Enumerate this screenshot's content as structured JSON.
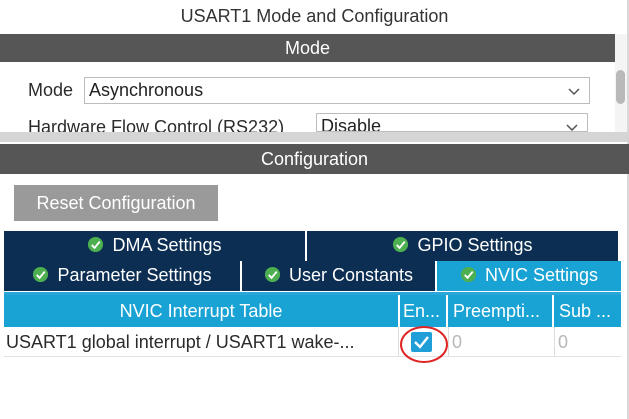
{
  "window": {
    "title": "USART1 Mode and Configuration"
  },
  "mode_section": {
    "header": "Mode",
    "rows": [
      {
        "label": "Mode",
        "value": "Asynchronous",
        "icon": "chevron-down-icon"
      },
      {
        "label": "Hardware Flow Control (RS232)",
        "value": "Disable",
        "icon": "chevron-down-icon"
      }
    ]
  },
  "configuration_section": {
    "header": "Configuration",
    "reset_label": "Reset Configuration",
    "tabs": [
      {
        "label": "DMA Settings",
        "icon": "check-circle-icon",
        "active": false
      },
      {
        "label": "GPIO Settings",
        "icon": "check-circle-icon",
        "active": false
      },
      {
        "label": "Parameter Settings",
        "icon": "check-circle-icon",
        "active": false
      },
      {
        "label": "User Constants",
        "icon": "check-circle-icon",
        "active": false
      },
      {
        "label": "NVIC Settings",
        "icon": "check-circle-icon",
        "active": true
      }
    ],
    "nvic_table": {
      "columns": [
        "NVIC Interrupt Table",
        "En...",
        "Preempti...",
        "Sub ..."
      ],
      "rows": [
        {
          "name": "USART1 global interrupt / USART1 wake-...",
          "enabled": true,
          "preemption": "0",
          "sub": "0"
        }
      ]
    }
  },
  "colors": {
    "header_gray": "#565656",
    "tab_navy": "#0c2e52",
    "tab_active_blue": "#19a3d4",
    "check_green": "#4caf50",
    "annotation_red": "#e02424"
  }
}
